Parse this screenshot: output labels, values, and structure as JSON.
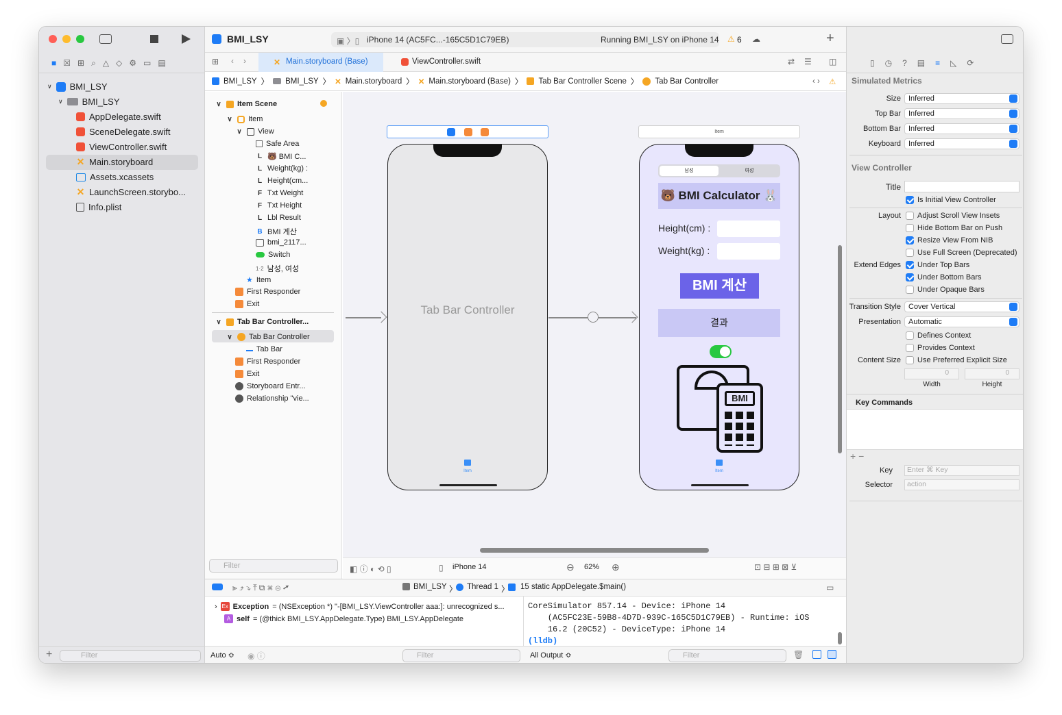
{
  "toolbar": {
    "project_name": "BMI_LSY",
    "scheme_target": "iPhone 14 (AC5FC...-165C5D1C79EB)",
    "status": "Running BMI_LSY on iPhone 14",
    "warning_count": "6"
  },
  "navigator": {
    "project_root": "BMI_LSY",
    "group": "BMI_LSY",
    "files": [
      "AppDelegate.swift",
      "SceneDelegate.swift",
      "ViewController.swift",
      "Main.storyboard",
      "Assets.xcassets",
      "LaunchScreen.storybo...",
      "Info.plist"
    ],
    "filter_placeholder": "Filter"
  },
  "tabs": {
    "active": "Main.storyboard (Base)",
    "other": "ViewController.swift"
  },
  "jumpbar": [
    "BMI_LSY",
    "BMI_LSY",
    "Main.storyboard",
    "Main.storyboard (Base)",
    "Tab Bar Controller Scene",
    "Tab Bar Controller"
  ],
  "outline": {
    "scene1": "Item Scene",
    "item": "Item",
    "view": "View",
    "children": [
      "Safe Area",
      "🐻 BMI C...",
      "Weight(kg) :",
      "Height(cm...",
      "Txt Weight",
      "Txt Height",
      "Lbl Result",
      "BMI 계산",
      "bmi_2117...",
      "Switch",
      "남성, 여성"
    ],
    "child_badges": [
      "",
      "L",
      "L",
      "L",
      "F",
      "F",
      "L",
      "B",
      "",
      "",
      ""
    ],
    "item2": "Item",
    "first_responder": "First Responder",
    "exit": "Exit",
    "scene2": "Tab Bar Controller...",
    "tbc": "Tab Bar Controller",
    "tab_bar": "Tab Bar",
    "first_responder2": "First Responder",
    "exit2": "Exit",
    "entry": "Storyboard Entr...",
    "relationship": "Relationship \"vie...",
    "filter_placeholder": "Filter"
  },
  "canvas": {
    "tbc_label": "Tab Bar Controller",
    "tab_item_label": "Item",
    "vc_header": "Item",
    "segment": [
      "남성",
      "여성"
    ],
    "title": "🐻 BMI Calculator 🐰",
    "height_label": "Height(cm) :",
    "weight_label": "Weight(kg) :",
    "button": "BMI 계산",
    "result": "결과",
    "device": "iPhone 14",
    "zoom": "62%"
  },
  "debug": {
    "breadcrumb": [
      "BMI_LSY",
      "Thread 1",
      "15 static AppDelegate.$main()"
    ],
    "vars": [
      {
        "name": "Exception",
        "value": "= (NSException *) \"-[BMI_LSY.ViewController aaa:]: unrecognized s..."
      },
      {
        "name": "self",
        "value": "= (@thick BMI_LSY.AppDelegate.Type) BMI_LSY.AppDelegate"
      }
    ],
    "console_lines": [
      "CoreSimulator 857.14 - Device: iPhone 14",
      "    (AC5FC23E-59B8-4D7D-939C-165C5D1C79EB) - Runtime: iOS",
      "    16.2 (20C52) - DeviceType: iPhone 14"
    ],
    "prompt": "(lldb)",
    "auto": "Auto ≎",
    "all_output": "All Output ≎",
    "filter_placeholder": "Filter"
  },
  "inspector": {
    "section1": "Simulated Metrics",
    "metrics": [
      {
        "label": "Size",
        "value": "Inferred"
      },
      {
        "label": "Top Bar",
        "value": "Inferred"
      },
      {
        "label": "Bottom Bar",
        "value": "Inferred"
      },
      {
        "label": "Keyboard",
        "value": "Inferred"
      }
    ],
    "section2": "View Controller",
    "title_label": "Title",
    "initial_vc": "Is Initial View Controller",
    "layout_label": "Layout",
    "layout_opts": [
      "Adjust Scroll View Insets",
      "Hide Bottom Bar on Push",
      "Resize View From NIB",
      "Use Full Screen (Deprecated)"
    ],
    "extend_label": "Extend Edges",
    "extend_opts": [
      "Under Top Bars",
      "Under Bottom Bars",
      "Under Opaque Bars"
    ],
    "transition_label": "Transition Style",
    "transition_value": "Cover Vertical",
    "presentation_label": "Presentation",
    "presentation_value": "Automatic",
    "context_opts": [
      "Defines Context",
      "Provides Context"
    ],
    "content_size_label": "Content Size",
    "content_size_opt": "Use Preferred Explicit Size",
    "width_value": "0",
    "height_value": "0",
    "width_label": "Width",
    "height_label": "Height",
    "key_commands": "Key Commands",
    "key_label": "Key",
    "key_placeholder": "Enter ⌘ Key",
    "selector_label": "Selector",
    "selector_placeholder": "action"
  },
  "colors": {
    "accent": "#1e7cf6",
    "purple_button": "#6b63e8",
    "light_purple": "#c9c8f5",
    "canvas_bg": "#f2f2f7"
  }
}
